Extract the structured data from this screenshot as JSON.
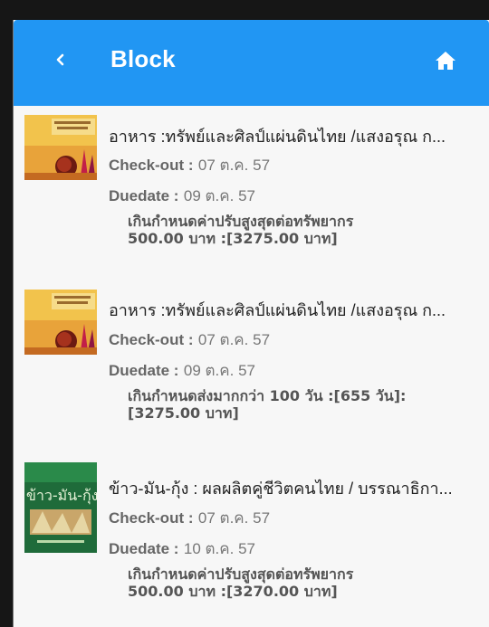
{
  "header": {
    "back_icon": "chevron-left-icon",
    "title": "Block",
    "home_icon": "home-icon",
    "background": "#2196f3"
  },
  "items": [
    {
      "cover": "orange-thai-food-book-cover",
      "title": "อาหาร :ทรัพย์และศิลป์แผ่นดินไทย /แสงอรุณ ก...",
      "checkout_label": "Check-out :",
      "checkout_value": "07 ต.ค. 57",
      "duedate_label": "Duedate :",
      "duedate_value": "09 ต.ค. 57",
      "fine_line1": "เกินกำหนดค่าปรับสูงสุดต่อทรัพยากร",
      "fine_line2": "500.00 บาท :[3275.00 บาท]"
    },
    {
      "cover": "orange-thai-food-book-cover",
      "title": "อาหาร :ทรัพย์และศิลป์แผ่นดินไทย /แสงอรุณ ก...",
      "checkout_label": "Check-out :",
      "checkout_value": "07 ต.ค. 57",
      "duedate_label": "Duedate :",
      "duedate_value": "09 ต.ค. 57",
      "fine_line1": "เกินกำหนดส่งมากกว่า 100 วัน :[655 วัน]:",
      "fine_line2": "[3275.00 บาท]"
    },
    {
      "cover": "green-rice-cassava-shrimp-book-cover",
      "title": "ข้าว-มัน-กุ้ง : ผลผลิตคู่ชีวิตคนไทย / บรรณาธิกา...",
      "checkout_label": "Check-out :",
      "checkout_value": "07 ต.ค. 57",
      "duedate_label": "Duedate :",
      "duedate_value": "10 ต.ค. 57",
      "fine_line1": "เกินกำหนดค่าปรับสูงสุดต่อทรัพยากร",
      "fine_line2": "500.00 บาท :[3270.00 บาท]"
    }
  ]
}
